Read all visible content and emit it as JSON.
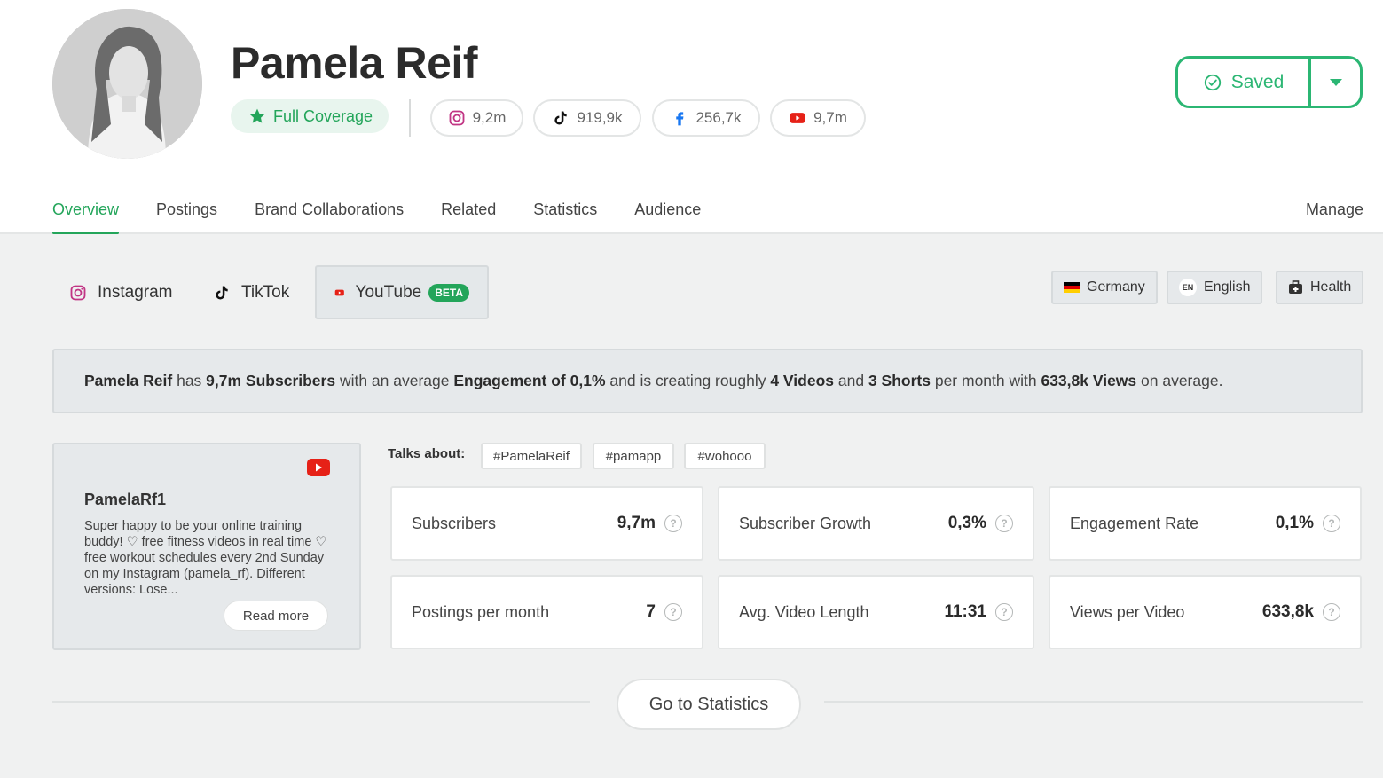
{
  "profile": {
    "name": "Pamela Reif",
    "coverage_label": "Full Coverage",
    "socials": [
      {
        "icon": "instagram-icon",
        "count": "9,2m"
      },
      {
        "icon": "tiktok-icon",
        "count": "919,9k"
      },
      {
        "icon": "facebook-icon",
        "count": "256,7k"
      },
      {
        "icon": "youtube-icon",
        "count": "9,7m"
      }
    ],
    "saved_label": "Saved"
  },
  "nav": {
    "tabs": [
      "Overview",
      "Postings",
      "Brand Collaborations",
      "Related",
      "Statistics",
      "Audience"
    ],
    "active": "Overview",
    "manage": "Manage"
  },
  "platforms": {
    "tabs": [
      "Instagram",
      "TikTok",
      "YouTube"
    ],
    "active": "YouTube",
    "beta": "BETA",
    "chips": {
      "country": "Germany",
      "language_code": "EN",
      "language": "English",
      "category": "Health"
    }
  },
  "summary": {
    "name": "Pamela Reif",
    "t1": " has ",
    "subs": "9,7m Subscribers",
    "t2": " with an average ",
    "eng": "Engagement of 0,1%",
    "t3": " and is creating roughly ",
    "videos": "4 Videos",
    "t4": " and ",
    "shorts": "3 Shorts",
    "t5": " per month with ",
    "views": "633,8k Views",
    "t6": " on average."
  },
  "bio": {
    "handle": "PamelaRf1",
    "text": "Super happy to be your online training buddy! ♡ free fitness videos in real time ♡ free workout schedules every 2nd Sunday on my Instagram (pamela_rf). Different versions: Lose...",
    "read_more": "Read more"
  },
  "talks": {
    "label": "Talks about:",
    "tags": [
      "#PamelaReif",
      "#pamapp",
      "#wohooo"
    ]
  },
  "stats": [
    {
      "label": "Subscribers",
      "value": "9,7m"
    },
    {
      "label": "Subscriber Growth",
      "value": "0,3%"
    },
    {
      "label": "Engagement Rate",
      "value": "0,1%"
    },
    {
      "label": "Postings per month",
      "value": "7"
    },
    {
      "label": "Avg. Video Length",
      "value": "11:31"
    },
    {
      "label": "Views per Video",
      "value": "633,8k"
    }
  ],
  "goto_label": "Go to Statistics",
  "colors": {
    "accent": "#23a55a",
    "saved": "#2bb673",
    "youtube": "#e62117",
    "instagram": "#c13584",
    "facebook": "#1877f2"
  }
}
